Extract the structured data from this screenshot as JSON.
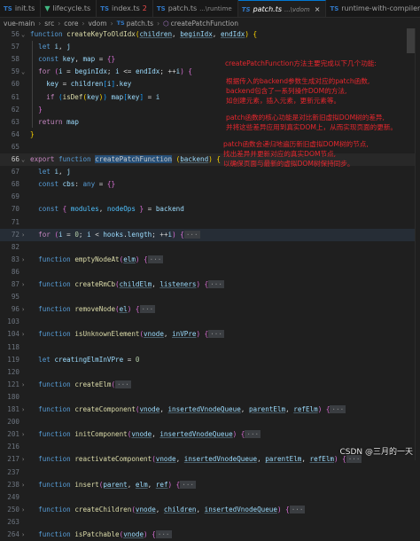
{
  "tabs": [
    {
      "icon": "TS",
      "label": "init.ts",
      "active": false
    },
    {
      "icon": "vue",
      "label": "lifecycle.ts",
      "active": false
    },
    {
      "icon": "TS",
      "label": "index.ts",
      "badge": "2",
      "active": false
    },
    {
      "icon": "TS",
      "label": "patch.ts",
      "desc": "...\\runtime",
      "active": false
    },
    {
      "icon": "TS",
      "label": "patch.ts",
      "desc": "...\\vdom",
      "close": "×",
      "active": true
    },
    {
      "icon": "TS",
      "label": "runtime-with-compiler.ts",
      "active": false
    }
  ],
  "breadcrumb": [
    "vue-main",
    "src",
    "core",
    "vdom",
    "patch.ts",
    "createPatchFunction"
  ],
  "breadcrumb_icon": "TS",
  "lines": [
    {
      "n": "56",
      "tokens": [
        [
          "kw",
          "function "
        ],
        [
          "fnn",
          "createKeyToOldIdx"
        ],
        [
          "br",
          "("
        ],
        [
          "pm",
          "children"
        ],
        [
          "op",
          ", "
        ],
        [
          "pm",
          "beginIdx"
        ],
        [
          "op",
          ", "
        ],
        [
          "pm",
          "endIdx"
        ],
        [
          "br",
          ")"
        ],
        [
          "op",
          " "
        ],
        [
          "br",
          "{"
        ]
      ]
    },
    {
      "n": "57",
      "tokens": [
        [
          "op",
          "  "
        ],
        [
          "kw",
          "let "
        ],
        [
          "vr",
          "i"
        ],
        [
          "op",
          ", "
        ],
        [
          "vr",
          "j"
        ]
      ]
    },
    {
      "n": "58",
      "tokens": [
        [
          "op",
          "  "
        ],
        [
          "kw",
          "const "
        ],
        [
          "vr",
          "key"
        ],
        [
          "op",
          ", "
        ],
        [
          "vr",
          "map"
        ],
        [
          "op",
          " = "
        ],
        [
          "br2",
          "{}"
        ]
      ]
    },
    {
      "n": "59",
      "tokens": [
        [
          "op",
          "  "
        ],
        [
          "ctl",
          "for "
        ],
        [
          "br2",
          "("
        ],
        [
          "vr",
          "i"
        ],
        [
          "op",
          " = "
        ],
        [
          "vr",
          "beginIdx"
        ],
        [
          "op",
          "; "
        ],
        [
          "vr",
          "i"
        ],
        [
          "op",
          " <= "
        ],
        [
          "vr",
          "endIdx"
        ],
        [
          "op",
          "; ++"
        ],
        [
          "vr",
          "i"
        ],
        [
          "br2",
          ")"
        ],
        [
          "op",
          " "
        ],
        [
          "br2",
          "{"
        ]
      ]
    },
    {
      "n": "60",
      "tokens": [
        [
          "op",
          "    "
        ],
        [
          "vr",
          "key"
        ],
        [
          "op",
          " = "
        ],
        [
          "vr",
          "children"
        ],
        [
          "br3",
          "["
        ],
        [
          "vr",
          "i"
        ],
        [
          "br3",
          "]"
        ],
        [
          "op",
          "."
        ],
        [
          "vr",
          "key"
        ]
      ]
    },
    {
      "n": "61",
      "tokens": [
        [
          "op",
          "    "
        ],
        [
          "ctl",
          "if "
        ],
        [
          "br3",
          "("
        ],
        [
          "fnn",
          "isDef"
        ],
        [
          "br",
          "("
        ],
        [
          "vr",
          "key"
        ],
        [
          "br",
          ")"
        ],
        [
          "br3",
          ")"
        ],
        [
          "op",
          " "
        ],
        [
          "vr",
          "map"
        ],
        [
          "br3",
          "["
        ],
        [
          "vr",
          "key"
        ],
        [
          "br3",
          "]"
        ],
        [
          "op",
          " = "
        ],
        [
          "vr",
          "i"
        ]
      ]
    },
    {
      "n": "62",
      "tokens": [
        [
          "op",
          "  "
        ],
        [
          "br2",
          "}"
        ]
      ]
    },
    {
      "n": "63",
      "tokens": [
        [
          "op",
          "  "
        ],
        [
          "ctl",
          "return "
        ],
        [
          "vr",
          "map"
        ]
      ]
    },
    {
      "n": "64",
      "tokens": [
        [
          "br",
          "}"
        ]
      ]
    },
    {
      "n": "65",
      "tokens": []
    },
    {
      "n": "66",
      "tokens": [
        [
          "ctl",
          "export "
        ],
        [
          "kw",
          "function "
        ],
        [
          "sel",
          "createPatchFunction"
        ],
        [
          "br",
          " ("
        ],
        [
          "pm",
          "backend"
        ],
        [
          "br",
          ")"
        ],
        [
          "op",
          " "
        ],
        [
          "br",
          "{"
        ]
      ]
    },
    {
      "n": "67",
      "tokens": [
        [
          "op",
          "  "
        ],
        [
          "kw",
          "let "
        ],
        [
          "vr",
          "i"
        ],
        [
          "op",
          ", "
        ],
        [
          "vr",
          "j"
        ]
      ]
    },
    {
      "n": "68",
      "tokens": [
        [
          "op",
          "  "
        ],
        [
          "kw",
          "const "
        ],
        [
          "vr",
          "cbs"
        ],
        [
          "op",
          ": "
        ],
        [
          "kw",
          "any"
        ],
        [
          "op",
          " = "
        ],
        [
          "br2",
          "{}"
        ]
      ]
    },
    {
      "n": "69",
      "tokens": []
    },
    {
      "n": "70",
      "tokens": [
        [
          "op",
          "  "
        ],
        [
          "kw",
          "const "
        ],
        [
          "br2",
          "{ "
        ],
        [
          "cn",
          "modules"
        ],
        [
          "op",
          ", "
        ],
        [
          "cn",
          "nodeOps"
        ],
        [
          "br2",
          " }"
        ],
        [
          "op",
          " = "
        ],
        [
          "vr",
          "backend"
        ]
      ]
    },
    {
      "n": "71",
      "tokens": []
    },
    {
      "n": "72",
      "tokens": [
        [
          "op",
          "  "
        ],
        [
          "ctl",
          "for "
        ],
        [
          "br2",
          "("
        ],
        [
          "vr",
          "i"
        ],
        [
          "op",
          " = "
        ],
        [
          "num",
          "0"
        ],
        [
          "op",
          "; "
        ],
        [
          "vr",
          "i"
        ],
        [
          "op",
          " < "
        ],
        [
          "vr",
          "hooks"
        ],
        [
          "op",
          "."
        ],
        [
          "vr",
          "length"
        ],
        [
          "op",
          "; ++"
        ],
        [
          "vr",
          "i"
        ],
        [
          "br2",
          ")"
        ],
        [
          "op",
          " "
        ],
        [
          "br2",
          "{"
        ],
        [
          "ellip",
          "···"
        ]
      ]
    },
    {
      "n": "82",
      "tokens": []
    },
    {
      "n": "83",
      "tokens": [
        [
          "op",
          "  "
        ],
        [
          "kw",
          "function "
        ],
        [
          "fnn",
          "emptyNodeAt"
        ],
        [
          "br2",
          "("
        ],
        [
          "pm",
          "elm"
        ],
        [
          "br2",
          ")"
        ],
        [
          "op",
          " "
        ],
        [
          "br2",
          "{"
        ],
        [
          "ellip",
          "···"
        ]
      ]
    },
    {
      "n": "86",
      "tokens": []
    },
    {
      "n": "87",
      "tokens": [
        [
          "op",
          "  "
        ],
        [
          "kw",
          "function "
        ],
        [
          "fnn",
          "createRmCb"
        ],
        [
          "br2",
          "("
        ],
        [
          "pm",
          "childElm"
        ],
        [
          "op",
          ", "
        ],
        [
          "pm",
          "listeners"
        ],
        [
          "br2",
          ")"
        ],
        [
          "op",
          " "
        ],
        [
          "br2",
          "{"
        ],
        [
          "ellip",
          "···"
        ]
      ]
    },
    {
      "n": "95",
      "tokens": []
    },
    {
      "n": "96",
      "tokens": [
        [
          "op",
          "  "
        ],
        [
          "kw",
          "function "
        ],
        [
          "fnn",
          "removeNode"
        ],
        [
          "br2",
          "("
        ],
        [
          "pm",
          "el"
        ],
        [
          "br2",
          ")"
        ],
        [
          "op",
          " "
        ],
        [
          "br2",
          "{"
        ],
        [
          "ellip",
          "···"
        ]
      ]
    },
    {
      "n": "103",
      "tokens": []
    },
    {
      "n": "104",
      "tokens": [
        [
          "op",
          "  "
        ],
        [
          "kw",
          "function "
        ],
        [
          "fnn",
          "isUnknownElement"
        ],
        [
          "br2",
          "("
        ],
        [
          "pm",
          "vnode"
        ],
        [
          "op",
          ", "
        ],
        [
          "pm",
          "inVPre"
        ],
        [
          "br2",
          ")"
        ],
        [
          "op",
          " "
        ],
        [
          "br2",
          "{"
        ],
        [
          "ellip",
          "···"
        ]
      ]
    },
    {
      "n": "118",
      "tokens": []
    },
    {
      "n": "119",
      "tokens": [
        [
          "op",
          "  "
        ],
        [
          "kw",
          "let "
        ],
        [
          "vr",
          "creatingElmInVPre"
        ],
        [
          "op",
          " = "
        ],
        [
          "num",
          "0"
        ]
      ]
    },
    {
      "n": "120",
      "tokens": []
    },
    {
      "n": "121",
      "tokens": [
        [
          "op",
          "  "
        ],
        [
          "kw",
          "function "
        ],
        [
          "fnn",
          "createElm"
        ],
        [
          "br2",
          "("
        ],
        [
          "ellip",
          "···"
        ]
      ]
    },
    {
      "n": "180",
      "tokens": []
    },
    {
      "n": "181",
      "tokens": [
        [
          "op",
          "  "
        ],
        [
          "kw",
          "function "
        ],
        [
          "fnn",
          "createComponent"
        ],
        [
          "br2",
          "("
        ],
        [
          "pm",
          "vnode"
        ],
        [
          "op",
          ", "
        ],
        [
          "pm",
          "insertedVnodeQueue"
        ],
        [
          "op",
          ", "
        ],
        [
          "pm",
          "parentElm"
        ],
        [
          "op",
          ", "
        ],
        [
          "pm",
          "refElm"
        ],
        [
          "br2",
          ")"
        ],
        [
          "op",
          " "
        ],
        [
          "br2",
          "{"
        ],
        [
          "ellip",
          "···"
        ]
      ]
    },
    {
      "n": "200",
      "tokens": []
    },
    {
      "n": "201",
      "tokens": [
        [
          "op",
          "  "
        ],
        [
          "kw",
          "function "
        ],
        [
          "fnn",
          "initComponent"
        ],
        [
          "br2",
          "("
        ],
        [
          "pm",
          "vnode"
        ],
        [
          "op",
          ", "
        ],
        [
          "pm",
          "insertedVnodeQueue"
        ],
        [
          "br2",
          ")"
        ],
        [
          "op",
          " "
        ],
        [
          "br2",
          "{"
        ],
        [
          "ellip",
          "···"
        ]
      ]
    },
    {
      "n": "216",
      "tokens": []
    },
    {
      "n": "217",
      "tokens": [
        [
          "op",
          "  "
        ],
        [
          "kw",
          "function "
        ],
        [
          "fnn",
          "reactivateComponent"
        ],
        [
          "br2",
          "("
        ],
        [
          "pm",
          "vnode"
        ],
        [
          "op",
          ", "
        ],
        [
          "pm",
          "insertedVnodeQueue"
        ],
        [
          "op",
          ", "
        ],
        [
          "pm",
          "parentElm"
        ],
        [
          "op",
          ", "
        ],
        [
          "pm",
          "refElm"
        ],
        [
          "br2",
          ")"
        ],
        [
          "op",
          " "
        ],
        [
          "br2",
          "{"
        ],
        [
          "ellip",
          "···"
        ]
      ]
    },
    {
      "n": "237",
      "tokens": []
    },
    {
      "n": "238",
      "tokens": [
        [
          "op",
          "  "
        ],
        [
          "kw",
          "function "
        ],
        [
          "fnn",
          "insert"
        ],
        [
          "br2",
          "("
        ],
        [
          "pm",
          "parent"
        ],
        [
          "op",
          ", "
        ],
        [
          "pm",
          "elm"
        ],
        [
          "op",
          ", "
        ],
        [
          "pm",
          "ref"
        ],
        [
          "br2",
          ")"
        ],
        [
          "op",
          " "
        ],
        [
          "br2",
          "{"
        ],
        [
          "ellip",
          "···"
        ]
      ]
    },
    {
      "n": "249",
      "tokens": []
    },
    {
      "n": "250",
      "tokens": [
        [
          "op",
          "  "
        ],
        [
          "kw",
          "function "
        ],
        [
          "fnn",
          "createChildren"
        ],
        [
          "br2",
          "("
        ],
        [
          "pm",
          "vnode"
        ],
        [
          "op",
          ", "
        ],
        [
          "pm",
          "children"
        ],
        [
          "op",
          ", "
        ],
        [
          "pm",
          "insertedVnodeQueue"
        ],
        [
          "br2",
          ")"
        ],
        [
          "op",
          " "
        ],
        [
          "br2",
          "{"
        ],
        [
          "ellip",
          "···"
        ]
      ]
    },
    {
      "n": "263",
      "tokens": []
    },
    {
      "n": "264",
      "tokens": [
        [
          "op",
          "  "
        ],
        [
          "kw",
          "function "
        ],
        [
          "fnn",
          "isPatchable"
        ],
        [
          "br2",
          "("
        ],
        [
          "pm",
          "vnode"
        ],
        [
          "br2",
          ")"
        ],
        [
          "op",
          " "
        ],
        [
          "br2",
          "{"
        ],
        [
          "ellip",
          "···"
        ]
      ]
    }
  ],
  "current_line": "66",
  "highlight_line": "72",
  "foldable_lines": [
    "56",
    "59",
    "66",
    "72",
    "83",
    "87",
    "96",
    "104",
    "121",
    "181",
    "201",
    "217",
    "238",
    "250",
    "264"
  ],
  "annotations": [
    [
      "createPatchFunction方法主要完成以下几个功能:"
    ],
    [
      "根据传入的backend参数生成对应的patch函数,",
      "backend包含了一系列操作DOM的方法,",
      "如创建元素，插入元素，更新元素等。"
    ],
    [
      "patch函数的核心功能是对比新旧虚拟DOM树的差异,",
      "并将这些差异应用到真实DOM上，从而实现页面的更新。"
    ],
    [
      "patch函数会递归地遍历新旧虚拟DOM树的节点,",
      "找出差异并更新对应的真实DOM节点,",
      "以确保页面与最新的虚拟DOM树保持同步。"
    ]
  ],
  "watermark": "CSDN @三月的一天",
  "colors": {
    "annotation": "#e8272e",
    "accent": "#0078d4",
    "background": "#1f1f1f"
  }
}
